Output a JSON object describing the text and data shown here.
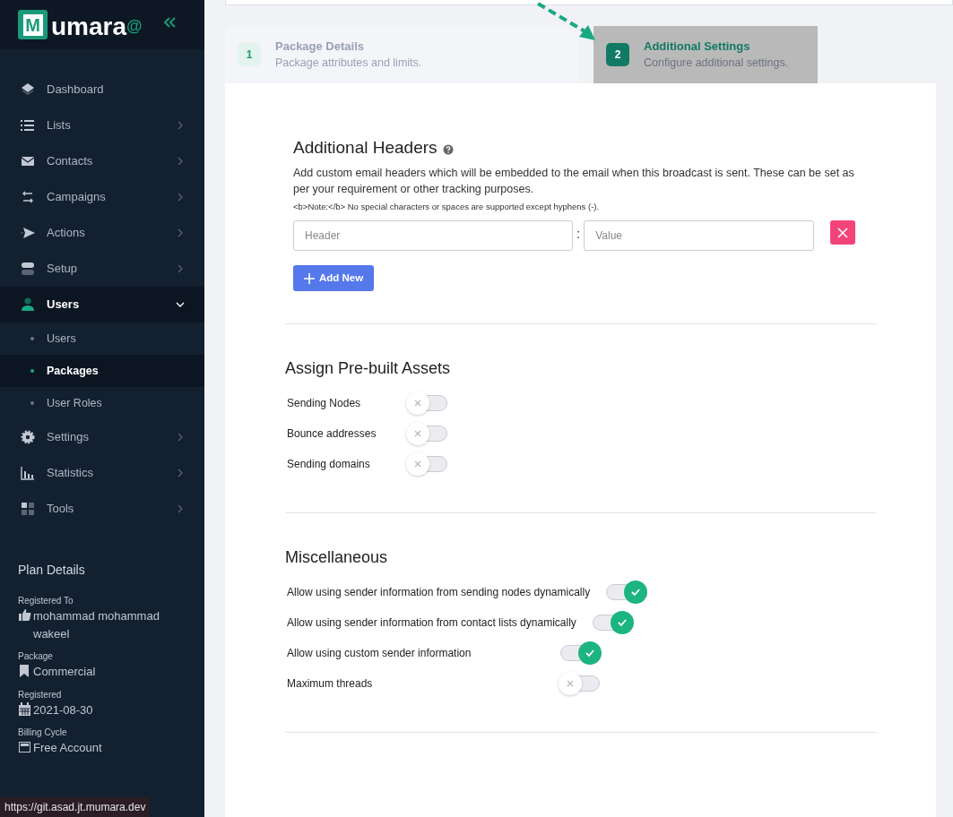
{
  "logo": {
    "letter": "M",
    "text": "umara",
    "superscript": "@"
  },
  "sidebar": {
    "items": [
      {
        "label": "Dashboard",
        "kind": "link",
        "selected": false
      },
      {
        "label": "Lists",
        "kind": "menu",
        "expanded": false,
        "selected": false
      },
      {
        "label": "Contacts",
        "kind": "menu",
        "expanded": false,
        "selected": false
      },
      {
        "label": "Campaigns",
        "kind": "menu",
        "expanded": false,
        "selected": false
      },
      {
        "label": "Actions",
        "kind": "menu",
        "expanded": false,
        "selected": false
      },
      {
        "label": "Setup",
        "kind": "menu",
        "expanded": false,
        "selected": false
      },
      {
        "label": "Users",
        "kind": "menu",
        "expanded": true,
        "selected": true,
        "children": [
          {
            "label": "Users",
            "selected": false
          },
          {
            "label": "Packages",
            "selected": true
          },
          {
            "label": "User Roles",
            "selected": false
          }
        ]
      },
      {
        "label": "Settings",
        "kind": "menu",
        "expanded": false,
        "selected": false
      },
      {
        "label": "Statistics",
        "kind": "menu",
        "expanded": false,
        "selected": false
      },
      {
        "label": "Tools",
        "kind": "menu",
        "expanded": false,
        "selected": false
      }
    ]
  },
  "plan": {
    "title": "Plan Details",
    "fields": [
      {
        "label": "Registered To",
        "value": "mohammad mohammad wakeel"
      },
      {
        "label": "Package",
        "value": "Commercial"
      },
      {
        "label": "Registered",
        "value": "2021-08-30"
      },
      {
        "label": "Billing Cycle",
        "value": "Free Account"
      }
    ]
  },
  "status_bar": {
    "url": "https://git.asad.jt.mumara.dev"
  },
  "steps": [
    {
      "number": "1",
      "title": "Package Details",
      "subtitle": "Package attributes and limits.",
      "selected": false
    },
    {
      "number": "2",
      "title": "Additional Settings",
      "subtitle": "Configure additional settings.",
      "selected": true
    }
  ],
  "headers": {
    "title": "Additional Headers",
    "description": "Add custom email headers which will be embedded to the email when this broadcast is sent. These can be set as per your requirement or other tracking purposes.",
    "note": "<b>Note:</b> No special characters or spaces are supported except hyphens (-).",
    "header_placeholder": "Header",
    "separator": ":",
    "value_placeholder": "Value",
    "add_button": "Add New"
  },
  "assets": {
    "title": "Assign Pre-built Assets",
    "toggles": [
      {
        "label": "Sending Nodes",
        "on": false
      },
      {
        "label": "Bounce addresses",
        "on": false
      },
      {
        "label": "Sending domains",
        "on": false
      }
    ]
  },
  "misc": {
    "title": "Miscellaneous",
    "toggles": [
      {
        "label": "Allow using sender information from sending nodes dynamically",
        "on": true
      },
      {
        "label": "Allow using sender information from contact lists dynamically",
        "on": true
      },
      {
        "label": "Allow using custom sender information",
        "on": true
      },
      {
        "label": "Maximum threads",
        "on": false
      }
    ]
  }
}
